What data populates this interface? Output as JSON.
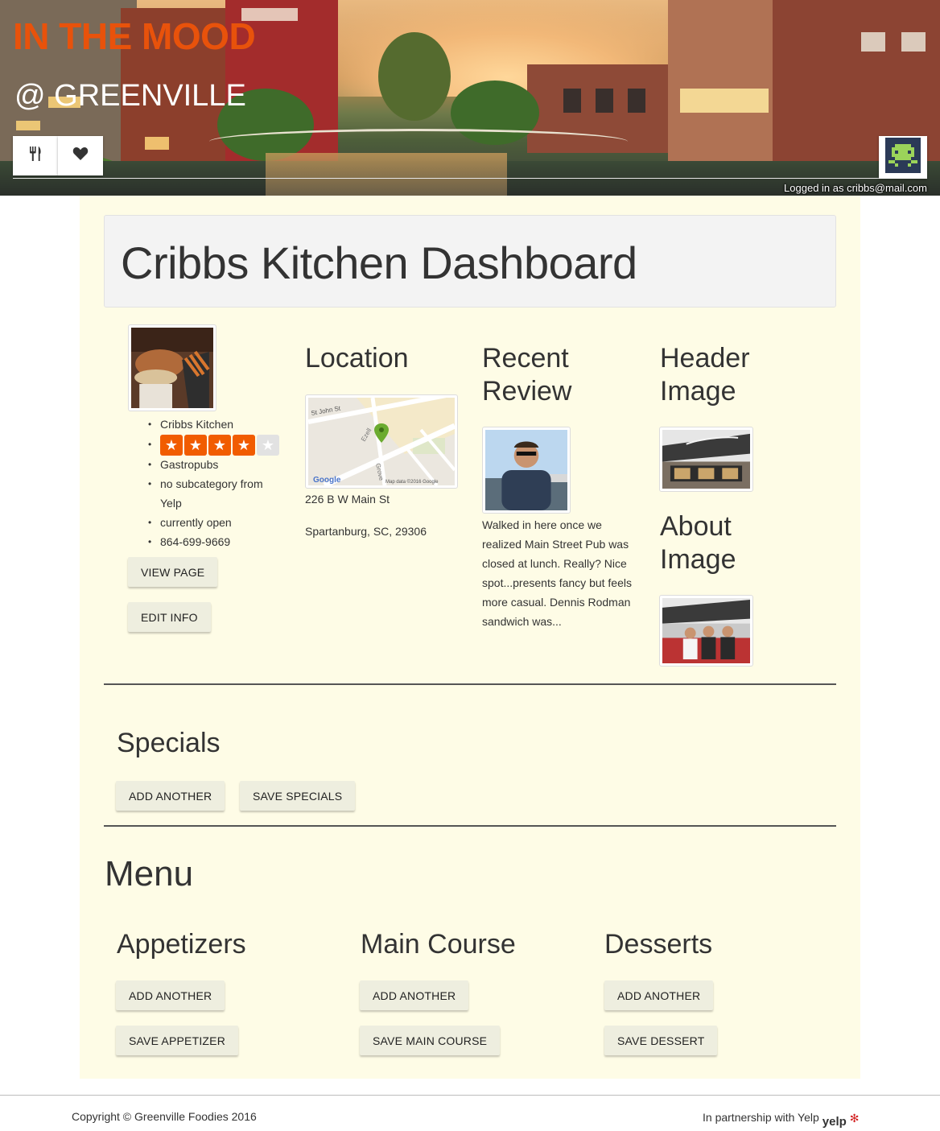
{
  "header": {
    "brand_title": "IN THE MOOD",
    "brand_subtitle": "@ GREENVILLE",
    "nav": [
      {
        "icon": "fork-knife-icon"
      },
      {
        "icon": "heart-icon"
      }
    ],
    "avatar_icon": "pixel-avatar-icon",
    "logged_in_text": "Logged in as cribbs@mail.com"
  },
  "dashboard": {
    "title": "Cribbs Kitchen Dashboard"
  },
  "restaurant": {
    "name": "Cribbs Kitchen",
    "rating": 4,
    "rating_max": 5,
    "category": "Gastropubs",
    "subcategory": "no subcategory from Yelp",
    "status": "currently open",
    "phone": "864-699-9669",
    "view_page_label": "VIEW PAGE",
    "edit_info_label": "EDIT INFO"
  },
  "location": {
    "heading": "Location",
    "map_labels": {
      "street1": "St John St",
      "street2": "Ezell",
      "street3": "Grove",
      "google": "Google",
      "attribution": "Map data ©2016 Google"
    },
    "address_line1": "226 B W Main St",
    "address_line2": "Spartanburg, SC, 29306"
  },
  "review": {
    "heading_line1": "Recent",
    "heading_line2": "Review",
    "text": "Walked in here once we realized Main Street Pub was closed at lunch. Really? Nice spot...presents fancy but feels more casual. Dennis Rodman sandwich was..."
  },
  "images": {
    "header_heading_line1": "Header",
    "header_heading_line2": "Image",
    "about_heading_line1": "About",
    "about_heading_line2": "Image"
  },
  "specials": {
    "heading": "Specials",
    "add_label": "ADD ANOTHER",
    "save_label": "SAVE SPECIALS"
  },
  "menu": {
    "heading": "Menu",
    "sections": [
      {
        "heading": "Appetizers",
        "add_label": "ADD ANOTHER",
        "save_label": "SAVE APPETIZER"
      },
      {
        "heading": "Main Course",
        "add_label": "ADD ANOTHER",
        "save_label": "SAVE MAIN COURSE"
      },
      {
        "heading": "Desserts",
        "add_label": "ADD ANOTHER",
        "save_label": "SAVE DESSERT"
      }
    ]
  },
  "footer": {
    "copyright": "Copyright © Greenville Foodies 2016",
    "partnership": "In partnership with Yelp",
    "yelp_logo": "yelp"
  },
  "colors": {
    "brand_orange": "#e8520b",
    "panel_bg": "#fefce6",
    "star_orange": "#f15c00"
  }
}
